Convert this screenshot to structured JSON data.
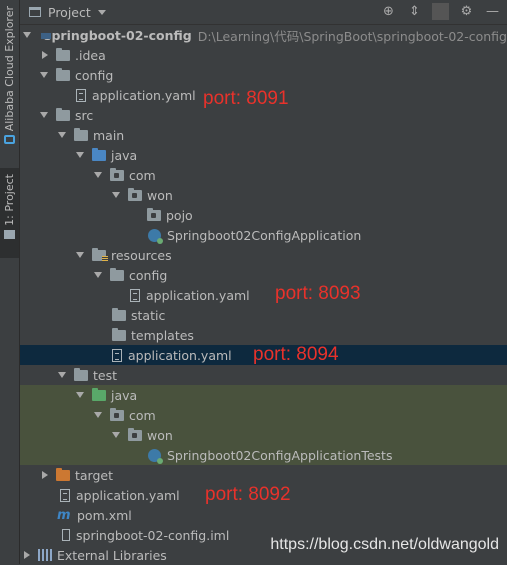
{
  "side_tabs": {
    "alibaba": "Alibaba Cloud Explorer",
    "project": "1: Project"
  },
  "topbar": {
    "title": "Project"
  },
  "tree": {
    "root": {
      "label": "springboot-02-config",
      "path": "D:\\Learning\\代码\\SpringBoot\\springboot-02-config"
    },
    "idea": ".idea",
    "config": "config",
    "config_app_yaml": "application.yaml",
    "src": "src",
    "main": "main",
    "java": "java",
    "com": "com",
    "won": "won",
    "pojo": "pojo",
    "main_class": "Springboot02ConfigApplication",
    "resources": "resources",
    "res_config": "config",
    "res_config_yaml": "application.yaml",
    "static": "static",
    "templates": "templates",
    "res_yaml": "application.yaml",
    "test": "test",
    "test_java": "java",
    "test_com": "com",
    "test_won": "won",
    "test_class": "Springboot02ConfigApplicationTests",
    "target": "target",
    "root_yaml": "application.yaml",
    "pom": "pom.xml",
    "iml": "springboot-02-config.iml",
    "ext_libs": "External Libraries"
  },
  "annotations": {
    "port_8091": "port: 8091",
    "port_8093": "port: 8093",
    "port_8094": "port: 8094",
    "port_8092": "port: 8092"
  },
  "watermark": "https://blog.csdn.net/oldwangold"
}
